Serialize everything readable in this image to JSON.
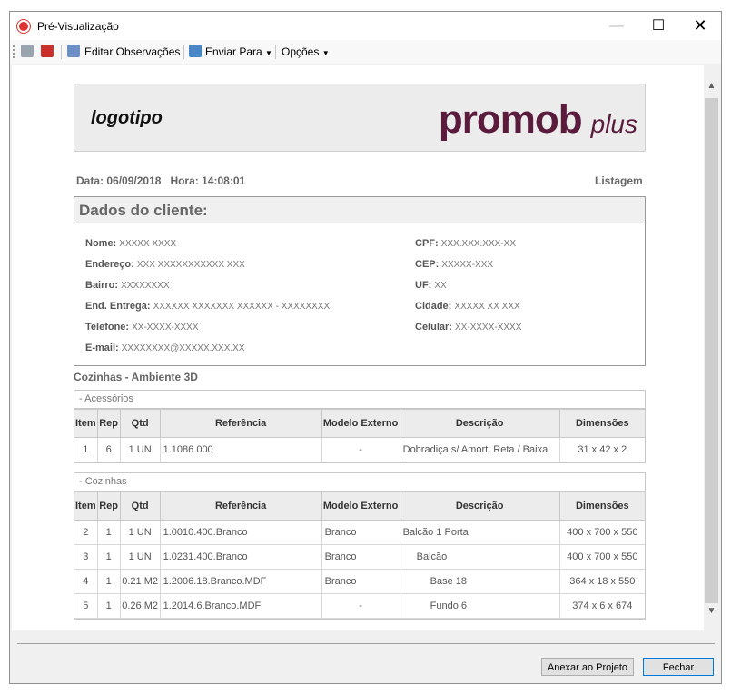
{
  "window": {
    "title": "Pré-Visualização"
  },
  "toolbar": {
    "edit_notes": "Editar Observações",
    "send_to": "Enviar Para",
    "options": "Opções"
  },
  "report": {
    "logo_text": "logotipo",
    "brand_main": "promob",
    "brand_plus": "plus",
    "date_label": "Data:",
    "date_value": "06/09/2018",
    "time_label": "Hora:",
    "time_value": "14:08:01",
    "listing": "Listagem",
    "client_title": "Dados do cliente:",
    "client": {
      "nome_label": "Nome:",
      "nome": "XXXXX XXXX",
      "endereco_label": "Endereço:",
      "endereco": "XXX XXXXXXXXXXX XXX",
      "bairro_label": "Bairro:",
      "bairro": "XXXXXXXX",
      "end_entrega_label": "End. Entrega:",
      "end_entrega": "XXXXXX XXXXXXX XXXXXX - XXXXXXXX",
      "telefone_label": "Telefone:",
      "telefone": "XX-XXXX-XXXX",
      "email_label": "E-mail:",
      "email": "XXXXXXXX@XXXXX.XXX.XX",
      "cpf_label": "CPF:",
      "cpf": "XXX.XXX.XXX-XX",
      "cep_label": "CEP:",
      "cep": "XXXXX-XXX",
      "uf_label": "UF:",
      "uf": "XX",
      "cidade_label": "Cidade:",
      "cidade": "XXXXX XX XXX",
      "celular_label": "Celular:",
      "celular": "XX-XXXX-XXXX"
    },
    "section_title": "Cozinhas - Ambiente 3D",
    "columns": [
      "Item",
      "Rep",
      "Qtd",
      "Referência",
      "Modelo Externo",
      "Descrição",
      "Dimensões"
    ],
    "groups": [
      {
        "name": "- Acessórios",
        "rows": [
          {
            "item": "1",
            "rep": "6",
            "qtd": "1 UN",
            "ref": "1.1086.000",
            "modelo": "-",
            "desc": "Dobradiça s/ Amort. Reta / Baixa",
            "dim": "31 x 42 x 2"
          }
        ]
      },
      {
        "name": "- Cozinhas",
        "rows": [
          {
            "item": "2",
            "rep": "1",
            "qtd": "1 UN",
            "ref": "1.0010.400.Branco",
            "modelo": "Branco",
            "desc": "Balcão 1 Porta",
            "dim": "400 x 700 x 550"
          },
          {
            "item": "3",
            "rep": "1",
            "qtd": "1 UN",
            "ref": "1.0231.400.Branco",
            "modelo": "Branco",
            "desc": "Balcão",
            "dim": "400 x 700 x 550"
          },
          {
            "item": "4",
            "rep": "1",
            "qtd": "0.21 M2",
            "ref": "1.2006.18.Branco.MDF",
            "modelo": "Branco",
            "desc": "Base 18",
            "dim": "364 x 18 x 550"
          },
          {
            "item": "5",
            "rep": "1",
            "qtd": "0.26 M2",
            "ref": "1.2014.6.Branco.MDF",
            "modelo": "-",
            "desc": "Fundo 6",
            "dim": "374 x 6 x 674"
          }
        ]
      }
    ]
  },
  "buttons": {
    "attach": "Anexar ao Projeto",
    "close": "Fechar"
  }
}
